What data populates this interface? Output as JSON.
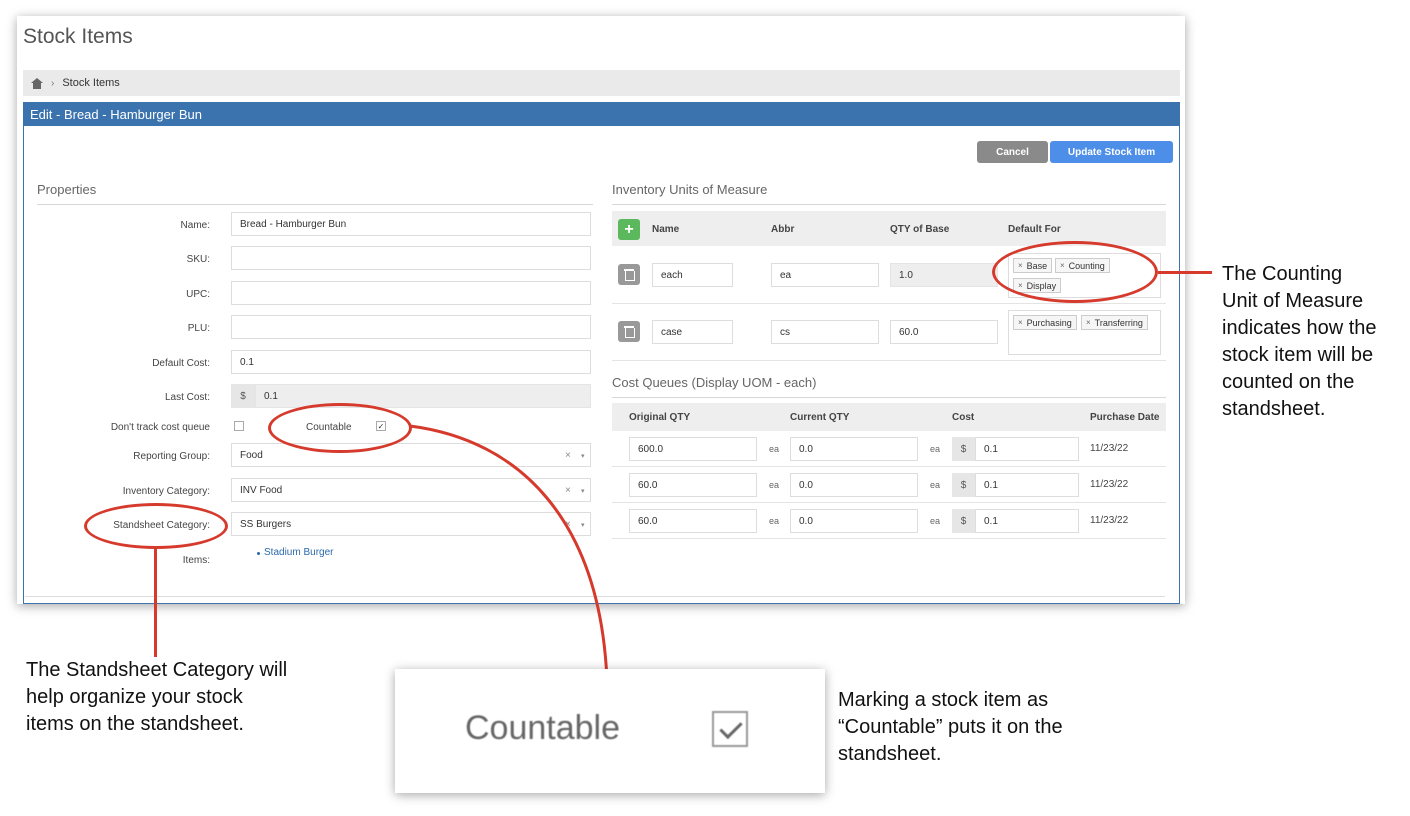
{
  "page_title": "Stock Items",
  "breadcrumb": {
    "home_icon": "home-icon",
    "separator": "›",
    "current": "Stock Items"
  },
  "panel": {
    "title": "Edit - Bread - Hamburger Bun",
    "cancel_label": "Cancel",
    "update_label": "Update Stock Item"
  },
  "properties": {
    "title": "Properties",
    "name_label": "Name:",
    "name_value": "Bread - Hamburger Bun",
    "sku_label": "SKU:",
    "sku_value": "",
    "upc_label": "UPC:",
    "upc_value": "",
    "plu_label": "PLU:",
    "plu_value": "",
    "default_cost_label": "Default Cost:",
    "default_cost_value": "0.1",
    "last_cost_label": "Last Cost:",
    "last_cost_currency": "$",
    "last_cost_value": "0.1",
    "dont_track_label": "Don't track cost queue",
    "dont_track_checked": false,
    "countable_label": "Countable",
    "countable_check": "✓",
    "reporting_group_label": "Reporting Group:",
    "reporting_group_value": "Food",
    "inventory_category_label": "Inventory Category:",
    "inventory_category_value": "INV Food",
    "standsheet_category_label": "Standsheet Category:",
    "standsheet_category_value": "SS Burgers",
    "items_label": "Items:",
    "items": [
      "Stadium Burger"
    ],
    "clear_symbol": "×",
    "caret_symbol": "▾"
  },
  "uom": {
    "title": "Inventory Units of Measure",
    "add_symbol": "+",
    "headers": {
      "name": "Name",
      "abbr": "Abbr",
      "qty": "QTY of Base",
      "default_for": "Default For"
    },
    "rows": [
      {
        "name": "each",
        "abbr": "ea",
        "qty": "1.0",
        "tags": [
          "Base",
          "Counting",
          "Display"
        ]
      },
      {
        "name": "case",
        "abbr": "cs",
        "qty": "60.0",
        "tags": [
          "Purchasing",
          "Transferring"
        ]
      }
    ],
    "tag_remove": "×"
  },
  "cost_queues": {
    "title": "Cost Queues (Display UOM - each)",
    "headers": {
      "original": "Original QTY",
      "current": "Current QTY",
      "cost": "Cost",
      "date": "Purchase Date"
    },
    "rows": [
      {
        "original": "600.0",
        "original_unit": "ea",
        "current": "0.0",
        "current_unit": "ea",
        "currency": "$",
        "cost": "0.1",
        "date": "11/23/22"
      },
      {
        "original": "60.0",
        "original_unit": "ea",
        "current": "0.0",
        "current_unit": "ea",
        "currency": "$",
        "cost": "0.1",
        "date": "11/23/22"
      },
      {
        "original": "60.0",
        "original_unit": "ea",
        "current": "0.0",
        "current_unit": "ea",
        "currency": "$",
        "cost": "0.1",
        "date": "11/23/22"
      }
    ]
  },
  "annotations": {
    "counting_uom": [
      "The Counting",
      "Unit of Measure",
      "indicates how the",
      "stock item will be",
      "counted on the",
      "standsheet."
    ],
    "standsheet_category": [
      "The Standsheet Category will",
      "help organize your stock",
      "items on the standsheet."
    ],
    "countable": [
      "Marking a stock item as",
      "“Countable” puts it on the",
      "standsheet."
    ],
    "zoom_label": "Countable",
    "accent_color": "#d53a2c"
  }
}
